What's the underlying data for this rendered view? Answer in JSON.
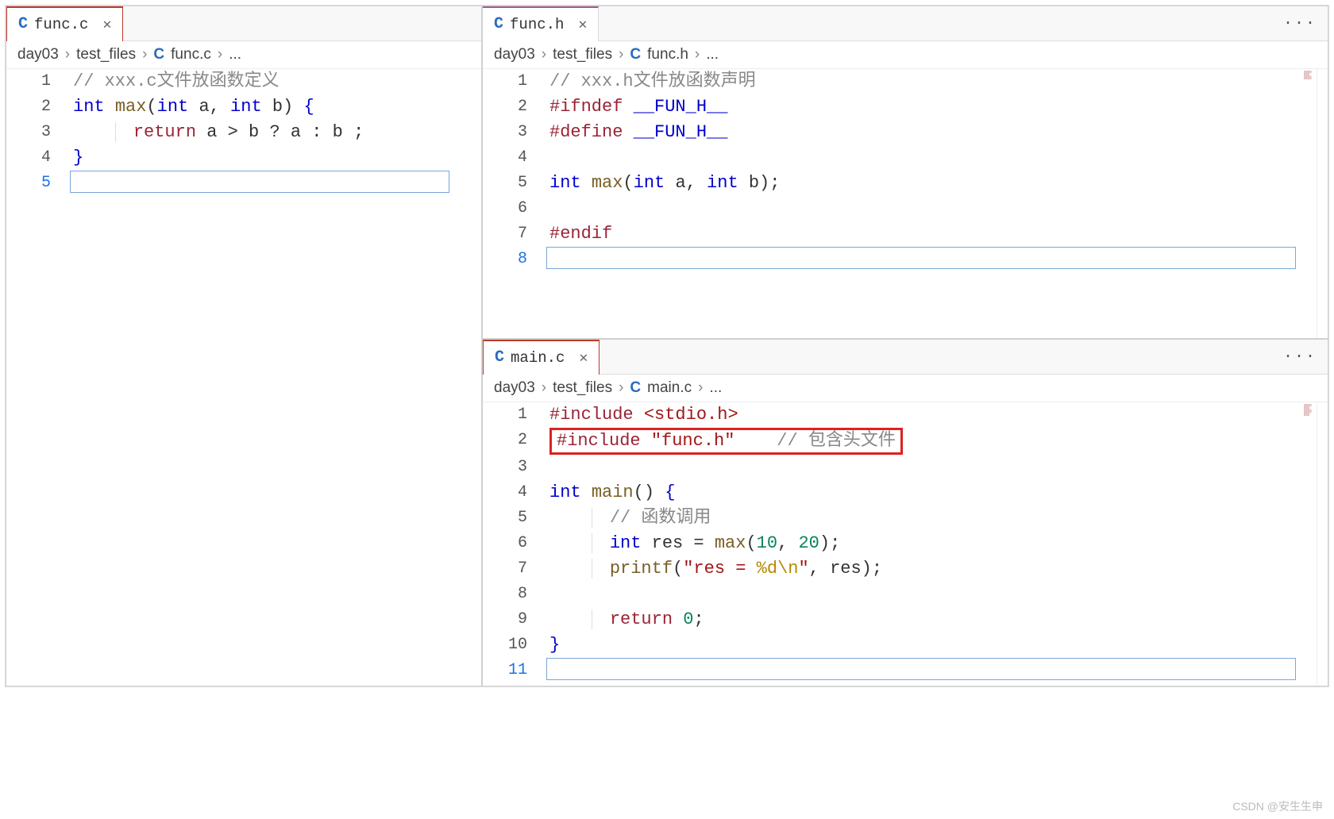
{
  "watermark": "CSDN @安生生申",
  "panes": {
    "top_left": {
      "tab": {
        "icon": "C",
        "name": "func.h"
      },
      "overflow": "···",
      "breadcrumb": [
        "day03",
        "test_files",
        {
          "icon": "C",
          "name": "func.h"
        },
        "..."
      ],
      "lines": [
        {
          "n": "1",
          "seg": [
            {
              "cls": "tok-comment-gray",
              "t": "// xxx.h文件放函数声明"
            }
          ]
        },
        {
          "n": "2",
          "seg": [
            {
              "cls": "tok-pp",
              "t": "#ifndef"
            },
            {
              "cls": "",
              "t": " "
            },
            {
              "cls": "tok-kw",
              "t": "__FUN_H__"
            }
          ]
        },
        {
          "n": "3",
          "seg": [
            {
              "cls": "tok-pp",
              "t": "#define"
            },
            {
              "cls": "",
              "t": " "
            },
            {
              "cls": "tok-kw",
              "t": "__FUN_H__"
            }
          ]
        },
        {
          "n": "4",
          "seg": []
        },
        {
          "n": "5",
          "seg": [
            {
              "cls": "tok-kw",
              "t": "int "
            },
            {
              "cls": "tok-fnname",
              "t": "max"
            },
            {
              "cls": "",
              "t": "("
            },
            {
              "cls": "tok-kw",
              "t": "int "
            },
            {
              "cls": "",
              "t": "a, "
            },
            {
              "cls": "tok-kw",
              "t": "int "
            },
            {
              "cls": "",
              "t": "b);"
            }
          ]
        },
        {
          "n": "6",
          "seg": []
        },
        {
          "n": "7",
          "seg": [
            {
              "cls": "tok-pp",
              "t": "#endif"
            }
          ]
        },
        {
          "n": "8",
          "cur": true,
          "seg": []
        }
      ]
    },
    "bottom_left": {
      "tab": {
        "icon": "C",
        "name": "main.c"
      },
      "overflow": "···",
      "breadcrumb": [
        "day03",
        "test_files",
        {
          "icon": "C",
          "name": "main.c"
        },
        "..."
      ],
      "lines": [
        {
          "n": "1",
          "seg": [
            {
              "cls": "tok-pp",
              "t": "#include "
            },
            {
              "cls": "tok-angle",
              "t": "<stdio.h>"
            }
          ]
        },
        {
          "n": "2",
          "hl": true,
          "seg": [
            {
              "cls": "tok-pp",
              "t": "#include "
            },
            {
              "cls": "tok-str",
              "t": "\"func.h\""
            },
            {
              "cls": "",
              "t": "    "
            },
            {
              "cls": "tok-comment-gray",
              "t": "// 包含头文件"
            }
          ]
        },
        {
          "n": "3",
          "seg": []
        },
        {
          "n": "4",
          "seg": [
            {
              "cls": "tok-kw",
              "t": "int "
            },
            {
              "cls": "tok-fnname",
              "t": "main"
            },
            {
              "cls": "",
              "t": "() "
            },
            {
              "cls": "tok-brace",
              "t": "{"
            }
          ]
        },
        {
          "n": "5",
          "indent": 1,
          "seg": [
            {
              "cls": "tok-comment-gray",
              "t": "// 函数调用"
            }
          ]
        },
        {
          "n": "6",
          "indent": 1,
          "seg": [
            {
              "cls": "tok-kw",
              "t": "int "
            },
            {
              "cls": "",
              "t": "res = "
            },
            {
              "cls": "tok-fnname",
              "t": "max"
            },
            {
              "cls": "",
              "t": "("
            },
            {
              "cls": "tok-num2",
              "t": "10"
            },
            {
              "cls": "",
              "t": ", "
            },
            {
              "cls": "tok-num2",
              "t": "20"
            },
            {
              "cls": "",
              "t": ");"
            }
          ]
        },
        {
          "n": "7",
          "indent": 1,
          "seg": [
            {
              "cls": "tok-fnname",
              "t": "printf"
            },
            {
              "cls": "",
              "t": "("
            },
            {
              "cls": "tok-str",
              "t": "\"res = "
            },
            {
              "cls": "tok-esc",
              "t": "%d"
            },
            {
              "cls": "tok-esc",
              "t": "\\n"
            },
            {
              "cls": "tok-str",
              "t": "\""
            },
            {
              "cls": "",
              "t": ", res);"
            }
          ]
        },
        {
          "n": "8",
          "seg": []
        },
        {
          "n": "9",
          "indent": 1,
          "seg": [
            {
              "cls": "tok-pp",
              "t": "return "
            },
            {
              "cls": "tok-num2",
              "t": "0"
            },
            {
              "cls": "",
              "t": ";"
            }
          ]
        },
        {
          "n": "10",
          "seg": [
            {
              "cls": "tok-brace",
              "t": "}"
            }
          ]
        },
        {
          "n": "11",
          "cur": true,
          "seg": []
        }
      ]
    },
    "right": {
      "tab": {
        "icon": "C",
        "name": "func.c"
      },
      "breadcrumb": [
        "day03",
        "test_files",
        {
          "icon": "C",
          "name": "func.c"
        },
        "..."
      ],
      "lines": [
        {
          "n": "1",
          "seg": [
            {
              "cls": "tok-comment-gray",
              "t": "// xxx.c文件放函数定义"
            }
          ]
        },
        {
          "n": "2",
          "seg": [
            {
              "cls": "tok-kw",
              "t": "int "
            },
            {
              "cls": "tok-fnname",
              "t": "max"
            },
            {
              "cls": "",
              "t": "("
            },
            {
              "cls": "tok-kw",
              "t": "int "
            },
            {
              "cls": "",
              "t": "a, "
            },
            {
              "cls": "tok-kw",
              "t": "int "
            },
            {
              "cls": "",
              "t": "b) "
            },
            {
              "cls": "tok-brace",
              "t": "{"
            }
          ]
        },
        {
          "n": "3",
          "indent": 1,
          "seg": [
            {
              "cls": "tok-pp",
              "t": "return "
            },
            {
              "cls": "",
              "t": "a > b ? a : b ;"
            }
          ]
        },
        {
          "n": "4",
          "seg": [
            {
              "cls": "tok-brace",
              "t": "}"
            }
          ]
        },
        {
          "n": "5",
          "cur": true,
          "seg": []
        }
      ]
    }
  }
}
